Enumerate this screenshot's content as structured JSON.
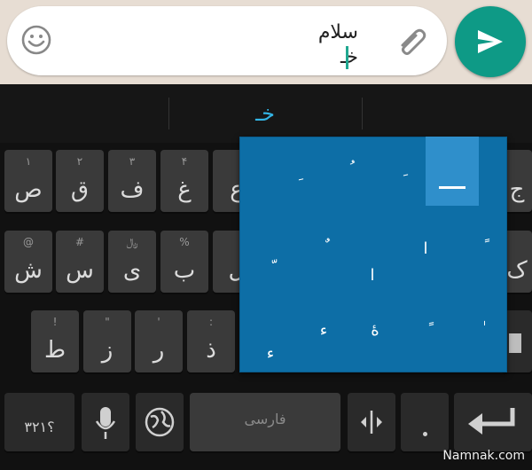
{
  "compose": {
    "line1": "سلام",
    "line2": "خـ"
  },
  "suggestion": "خـ",
  "keys": {
    "row1": [
      {
        "main": "ص",
        "hint": "۱"
      },
      {
        "main": "ق",
        "hint": "۲"
      },
      {
        "main": "ف",
        "hint": "۳"
      },
      {
        "main": "غ",
        "hint": "۴"
      },
      {
        "main": "ع",
        "hint": ""
      },
      {
        "main": "ج",
        "hint": ""
      }
    ],
    "row2": [
      {
        "main": "ش",
        "hint": "@"
      },
      {
        "main": "س",
        "hint": "#"
      },
      {
        "main": "ی",
        "hint": "﷼"
      },
      {
        "main": "ب",
        "hint": "%"
      },
      {
        "main": "ل",
        "hint": ""
      },
      {
        "main": "ک",
        "hint": ""
      }
    ],
    "row3": [
      {
        "main": "ط",
        "hint": "!"
      },
      {
        "main": "ز",
        "hint": "\""
      },
      {
        "main": "ر",
        "hint": "'"
      },
      {
        "main": "ذ",
        "hint": ":"
      }
    ],
    "symbols_label": "؟۳۲۱",
    "space_label": "فارسی"
  },
  "popup": {
    "diacritics": [
      "َ",
      "ُ",
      "ِ",
      "ـ",
      "ّ",
      "ٌ",
      "ً",
      "ا",
      "ٔ",
      "ٕ",
      "ٓ",
      "ٍ",
      "ء",
      "ۀ",
      "ٰ"
    ]
  },
  "watermark": "Namnak.com"
}
